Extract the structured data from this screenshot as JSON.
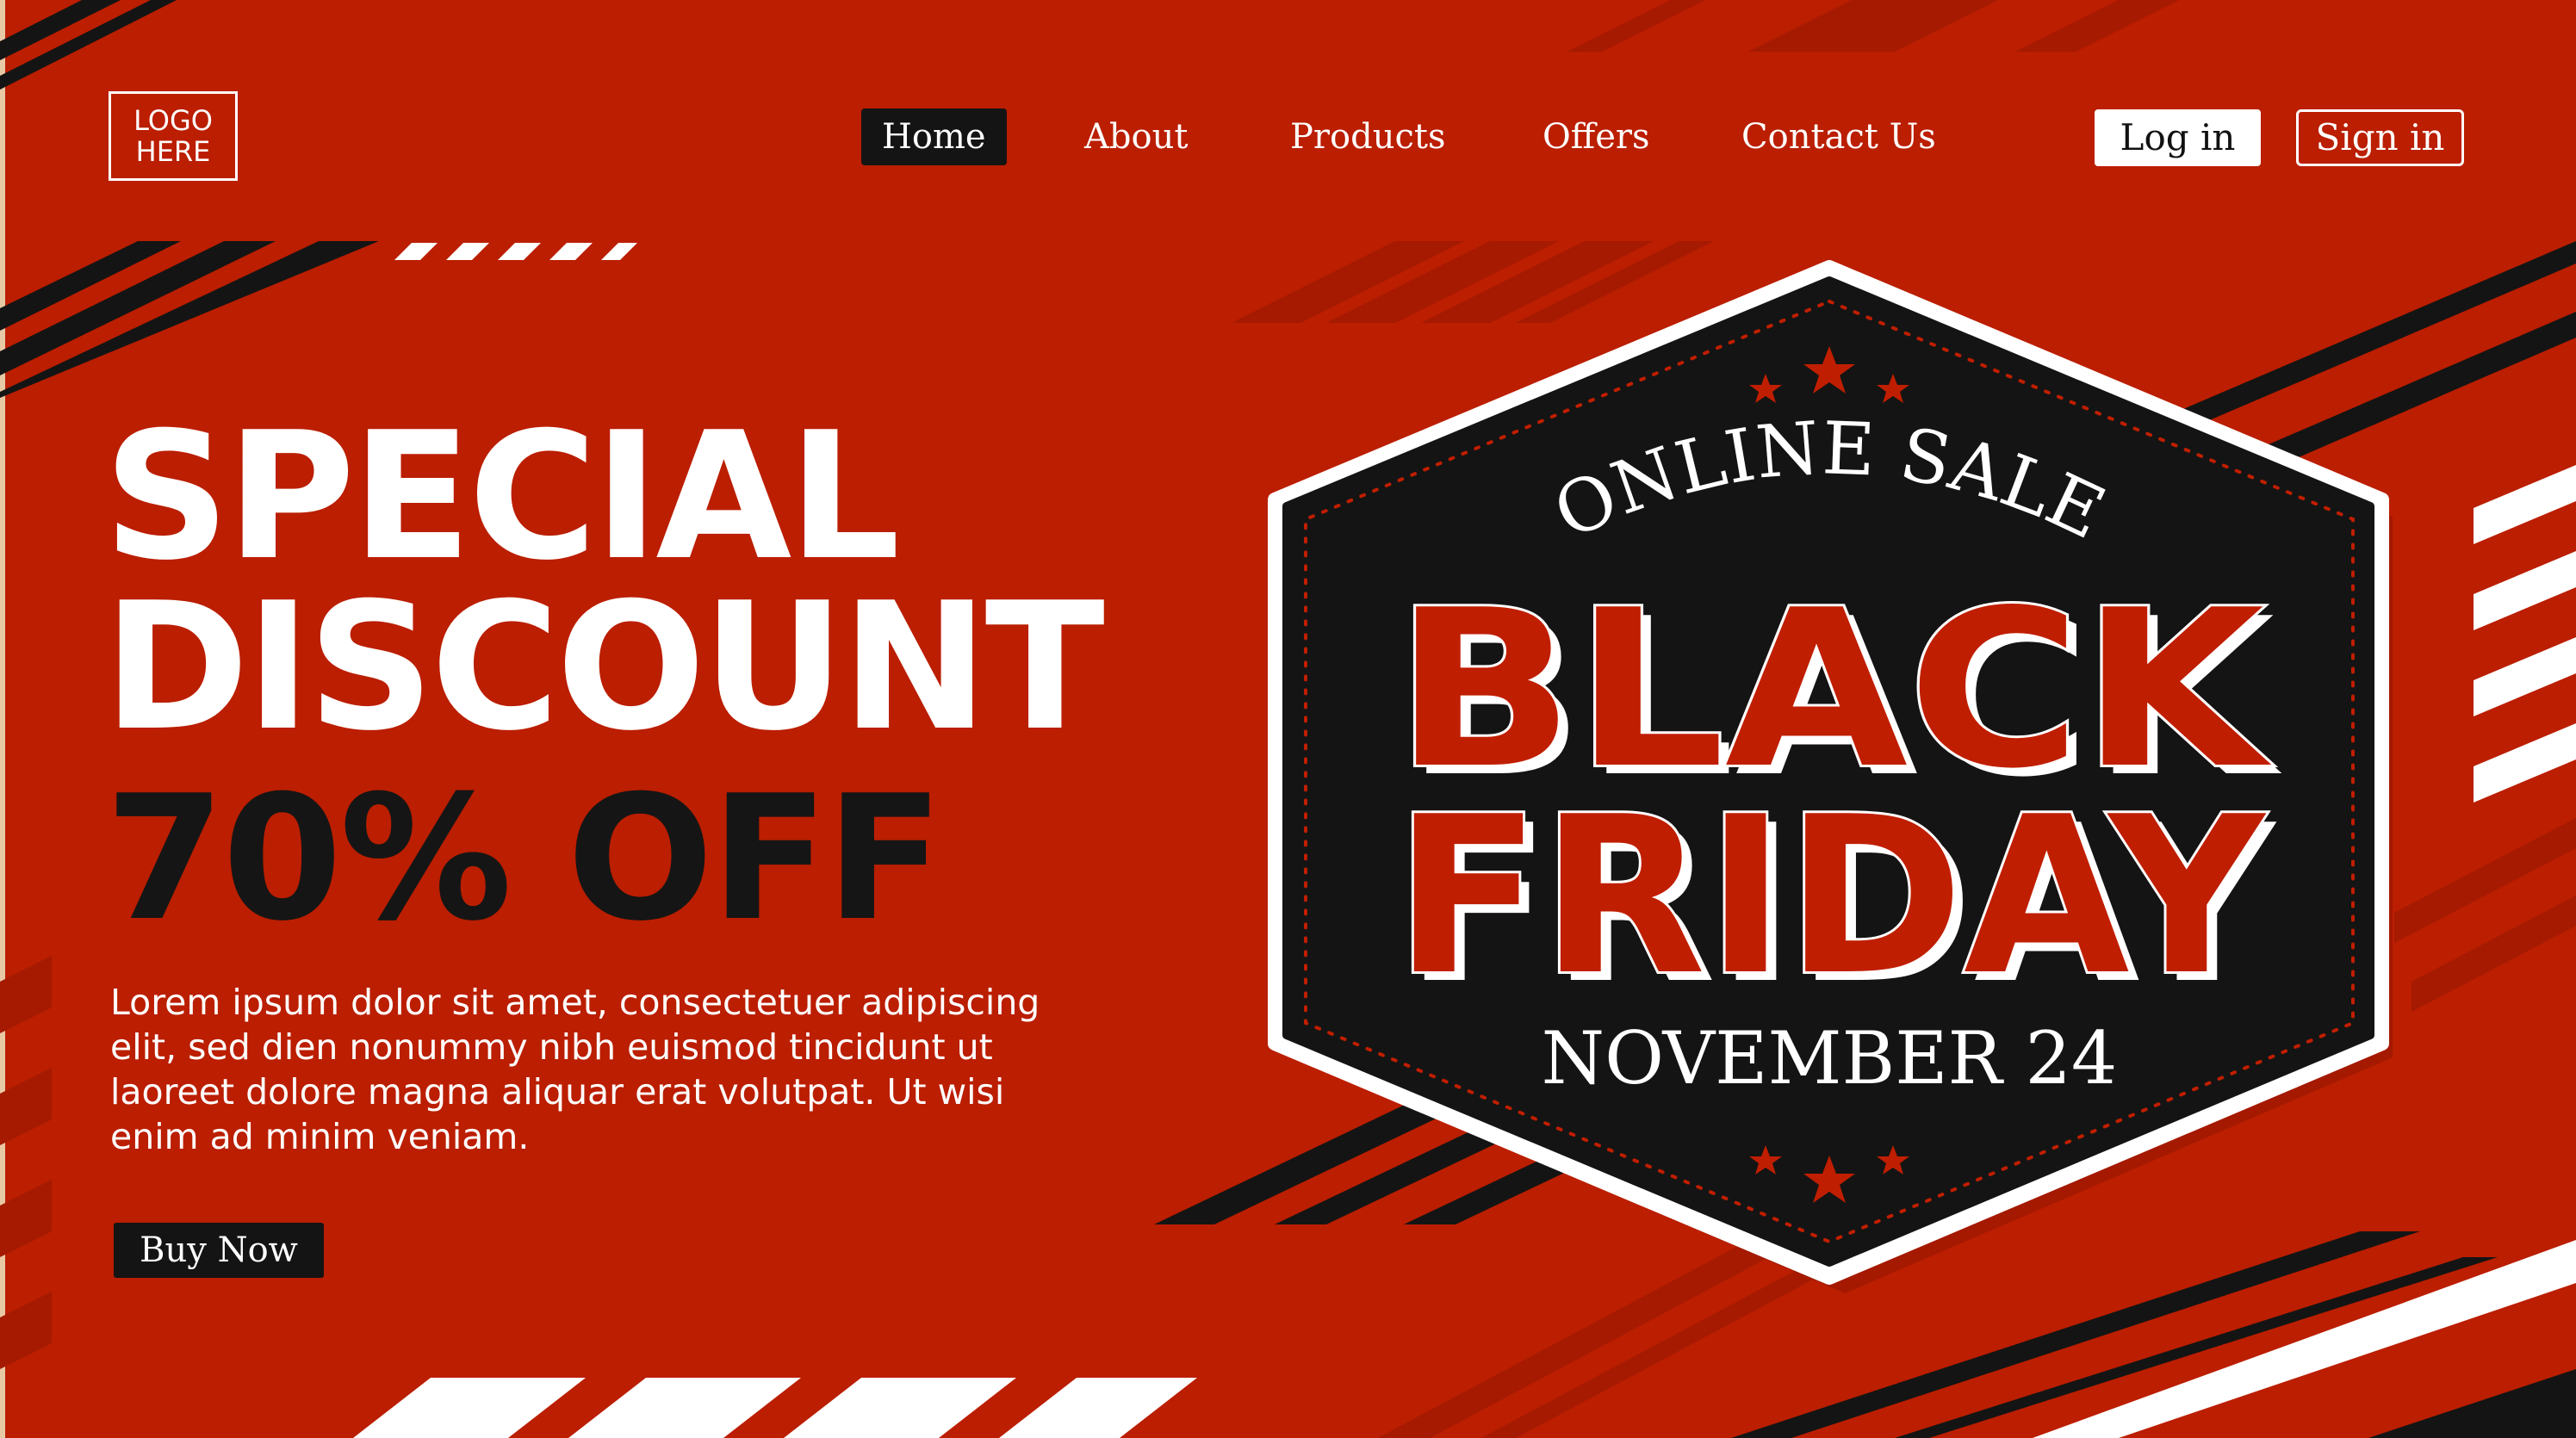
{
  "logo": {
    "line1": "LOGO",
    "line2": "HERE"
  },
  "nav": {
    "home": "Home",
    "about": "About",
    "products": "Products",
    "offers": "Offers",
    "contact": "Contact Us"
  },
  "auth": {
    "login": "Log in",
    "signin": "Sign in"
  },
  "hero": {
    "line1": "SPECIAL",
    "line2": "DISCOUNT",
    "discount": "70% OFF",
    "body": "Lorem ipsum dolor sit amet, consectetuer adipiscing elit, sed dien nonummy nibh euismod tincidunt ut laoreet dolore magna aliquar erat volutpat. Ut wisi enim ad minim veniam.",
    "cta": "Buy Now"
  },
  "badge": {
    "top": "ONLINE SALE",
    "word1": "BLACK",
    "word2": "FRIDAY",
    "date": "NOVEMBER 24"
  },
  "colors": {
    "background": "#bb1e00",
    "dark": "#141414",
    "white": "#ffffff",
    "accent_red": "#c01e00"
  }
}
